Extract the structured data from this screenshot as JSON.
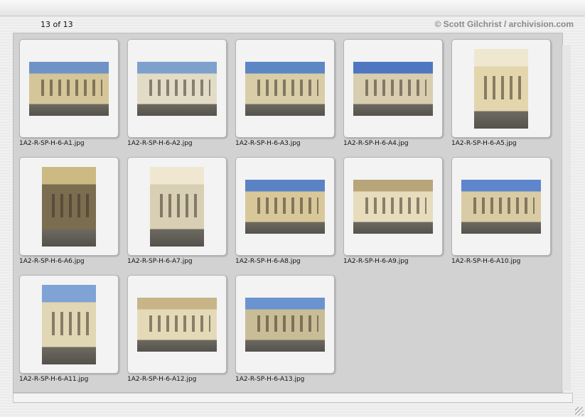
{
  "header": {
    "count_label": "13 of 13",
    "credit": "© Scott Gilchrist / archivision.com"
  },
  "thumbnails": [
    {
      "label": "1A2-R-SP-H-6-A1.jpg",
      "orientation": "landscape",
      "sky": "#6f93c6",
      "wall": "#d4c698"
    },
    {
      "label": "1A2-R-SP-H-6-A2.jpg",
      "orientation": "landscape",
      "sky": "#7ea0cc",
      "wall": "#e2dcc6"
    },
    {
      "label": "1A2-R-SP-H-6-A3.jpg",
      "orientation": "landscape",
      "sky": "#5d86c4",
      "wall": "#d8cda7"
    },
    {
      "label": "1A2-R-SP-H-6-A4.jpg",
      "orientation": "landscape",
      "sky": "#4e77c0",
      "wall": "#d9cdb0"
    },
    {
      "label": "1A2-R-SP-H-6-A5.jpg",
      "orientation": "portrait",
      "sky": "#efe7cf",
      "wall": "#e3d6ad"
    },
    {
      "label": "1A2-R-SP-H-6-A6.jpg",
      "orientation": "portrait",
      "sky": "#cdb982",
      "wall": "#7a6d50"
    },
    {
      "label": "1A2-R-SP-H-6-A7.jpg",
      "orientation": "portrait",
      "sky": "#efe7cf",
      "wall": "#d8cfb4"
    },
    {
      "label": "1A2-R-SP-H-6-A8.jpg",
      "orientation": "landscape",
      "sky": "#5a83c6",
      "wall": "#d8c899"
    },
    {
      "label": "1A2-R-SP-H-6-A9.jpg",
      "orientation": "landscape",
      "sky": "#b8a57a",
      "wall": "#e7dcbb"
    },
    {
      "label": "1A2-R-SP-H-6-A10.jpg",
      "orientation": "landscape",
      "sky": "#5f85cc",
      "wall": "#d9cba3"
    },
    {
      "label": "1A2-R-SP-H-6-A11.jpg",
      "orientation": "portrait",
      "sky": "#7ea3d4",
      "wall": "#e2d7b4"
    },
    {
      "label": "1A2-R-SP-H-6-A12.jpg",
      "orientation": "landscape",
      "sky": "#c7b587",
      "wall": "#e5dab8"
    },
    {
      "label": "1A2-R-SP-H-6-A13.jpg",
      "orientation": "landscape",
      "sky": "#6a93d0",
      "wall": "#c9bd98"
    }
  ]
}
